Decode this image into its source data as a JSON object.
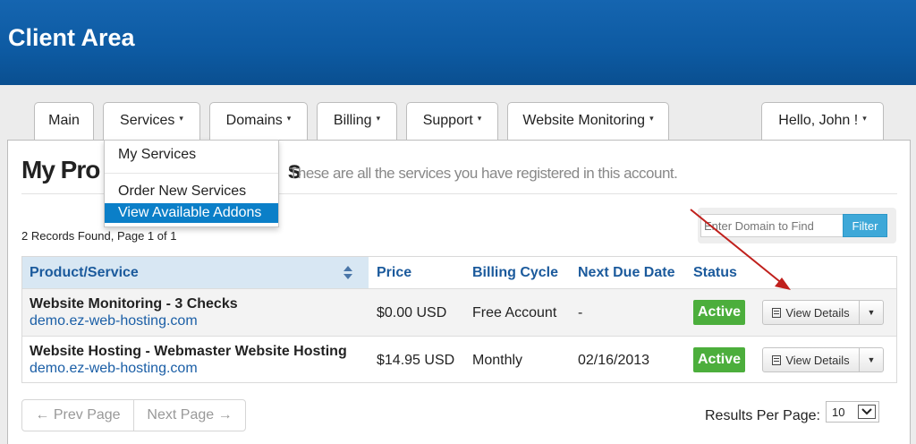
{
  "header": {
    "title": "Client Area"
  },
  "nav": {
    "tabs": [
      {
        "label": "Main"
      },
      {
        "label": "Services",
        "caret": "▾"
      },
      {
        "label": "Domains",
        "caret": "▾"
      },
      {
        "label": "Billing",
        "caret": "▾"
      },
      {
        "label": "Support",
        "caret": "▾"
      },
      {
        "label": "Website Monitoring",
        "caret": "▾"
      }
    ],
    "user_menu": {
      "label": "Hello, John !",
      "caret": "▾"
    }
  },
  "services_dropdown": {
    "items": [
      {
        "label": "My Services"
      },
      {
        "label": "Order New Services"
      },
      {
        "label": "View Available Addons",
        "highlighted": true
      }
    ]
  },
  "page": {
    "title": "My Products & Services",
    "title_visible": "My Pro",
    "title_tail": "s",
    "subtitle": "These are all the services you have registered in this account."
  },
  "records_info": "2 Records Found, Page 1 of 1",
  "filter": {
    "placeholder": "Enter Domain to Find",
    "button_label": "Filter"
  },
  "table": {
    "columns": [
      "Product/Service",
      "Price",
      "Billing Cycle",
      "Next Due Date",
      "Status"
    ],
    "rows": [
      {
        "product": "Website Monitoring - 3 Checks",
        "domain": "demo.ez-web-hosting.com",
        "price": "$0.00 USD",
        "billing_cycle": "Free Account",
        "next_due": "-",
        "status": "Active",
        "action": "View Details"
      },
      {
        "product": "Website Hosting - Webmaster Website Hosting",
        "domain": "demo.ez-web-hosting.com",
        "price": "$14.95 USD",
        "billing_cycle": "Monthly",
        "next_due": "02/16/2013",
        "status": "Active",
        "action": "View Details"
      }
    ]
  },
  "pagination": {
    "prev": "← Prev Page",
    "next": "Next Page →"
  },
  "results_per_page": {
    "label": "Results Per Page:",
    "value": "10"
  },
  "colors": {
    "header_blue": "#0d5aa2",
    "link_blue": "#1a5ea6",
    "active_green": "#4cae3c",
    "highlight_blue": "#0b7fc8",
    "annotation_red": "#c0201c"
  },
  "icons": {
    "sort": "sort-up-down-icon",
    "details": "document-icon",
    "caret": "chevron-down-icon",
    "annotation": "red-arrow"
  }
}
